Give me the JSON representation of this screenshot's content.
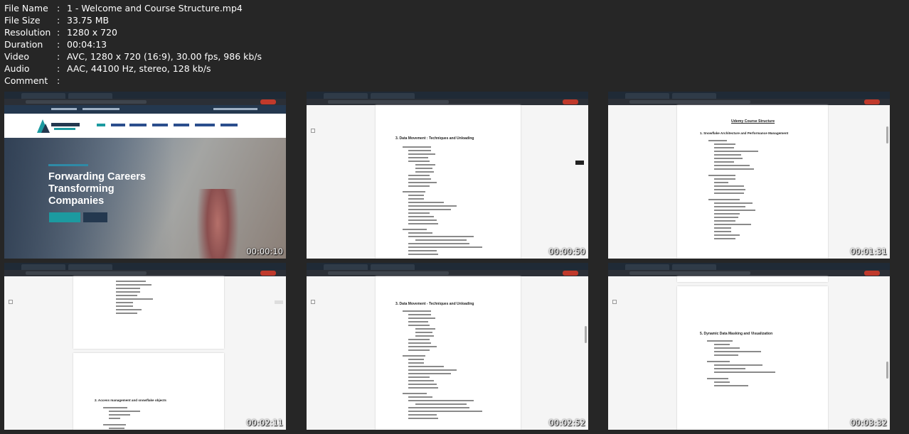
{
  "metadata": [
    {
      "key": "File Name",
      "value": "1 - Welcome and Course Structure.mp4"
    },
    {
      "key": "File Size",
      "value": "33.75 MB"
    },
    {
      "key": "Resolution",
      "value": "1280 x 720"
    },
    {
      "key": "Duration",
      "value": "00:04:13"
    },
    {
      "key": "Video",
      "value": "AVC, 1280 x 720 (16:9), 30.00 fps, 986 kb/s"
    },
    {
      "key": "Audio",
      "value": "AAC, 44100 Hz, stereo, 128 kb/s"
    },
    {
      "key": "Comment",
      "value": ""
    }
  ],
  "thumbnails": [
    {
      "timestamp": "00:00:10",
      "hero_lines": [
        "Forwarding Careers",
        "Transforming",
        "Companies"
      ]
    },
    {
      "timestamp": "00:00:50",
      "doc_heading": "3. Data Movement : Techniques and Unloading"
    },
    {
      "timestamp": "00:01:31",
      "doc_title": "Udemy Course Structure",
      "doc_heading": "1. Snowflake Architecture and Performance Management"
    },
    {
      "timestamp": "00:02:11",
      "doc_heading": "2. Access management and snowflake objects"
    },
    {
      "timestamp": "00:02:52",
      "doc_heading": "3. Data Movement - Techniques and Unloading"
    },
    {
      "timestamp": "00:03:32",
      "doc_heading": "5. Dynamic Data Masking and Visualization"
    }
  ]
}
